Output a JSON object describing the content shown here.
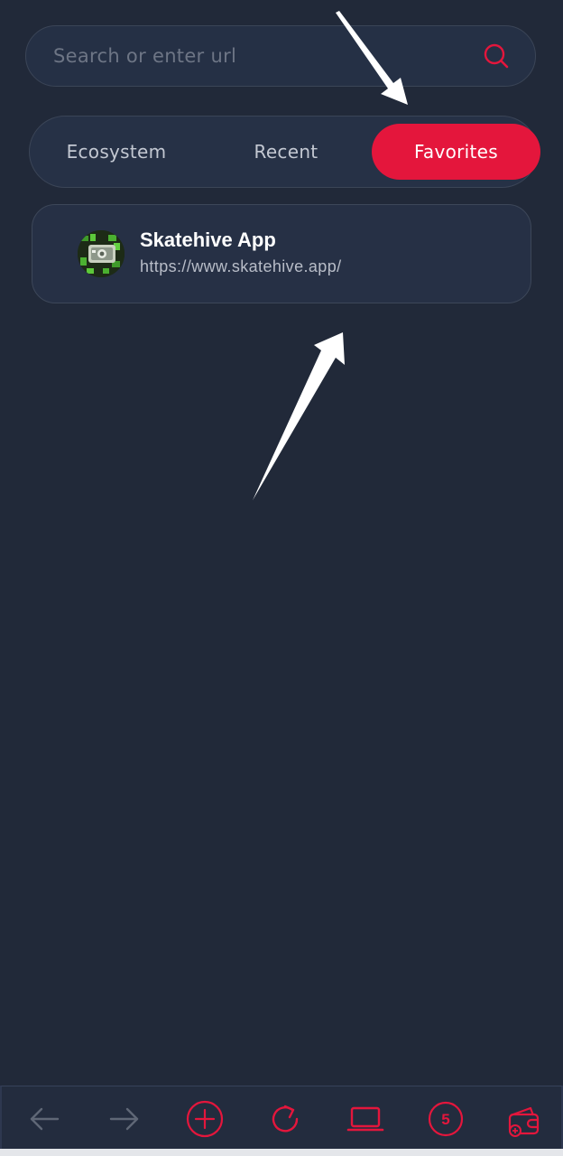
{
  "search": {
    "placeholder": "Search or enter url"
  },
  "tabs": [
    {
      "label": "Ecosystem",
      "active": false
    },
    {
      "label": "Recent",
      "active": false
    },
    {
      "label": "Favorites",
      "active": true
    }
  ],
  "favorites": [
    {
      "title": "Skatehive App",
      "url": "https://www.skatehive.app/",
      "icon": "skatehive-logo-icon"
    }
  ],
  "tabs_count": "5",
  "colors": {
    "background": "#212939",
    "accent": "#e4163c",
    "card": "#263045",
    "muted_icon": "#5f6776"
  },
  "bottom_nav": [
    {
      "icon": "back-arrow-icon",
      "enabled": false
    },
    {
      "icon": "forward-arrow-icon",
      "enabled": false
    },
    {
      "icon": "new-tab-icon",
      "enabled": true
    },
    {
      "icon": "refresh-icon",
      "enabled": true
    },
    {
      "icon": "desktop-mode-icon",
      "enabled": true
    },
    {
      "icon": "tab-count-icon",
      "enabled": true
    },
    {
      "icon": "wallet-icon",
      "enabled": true
    }
  ]
}
